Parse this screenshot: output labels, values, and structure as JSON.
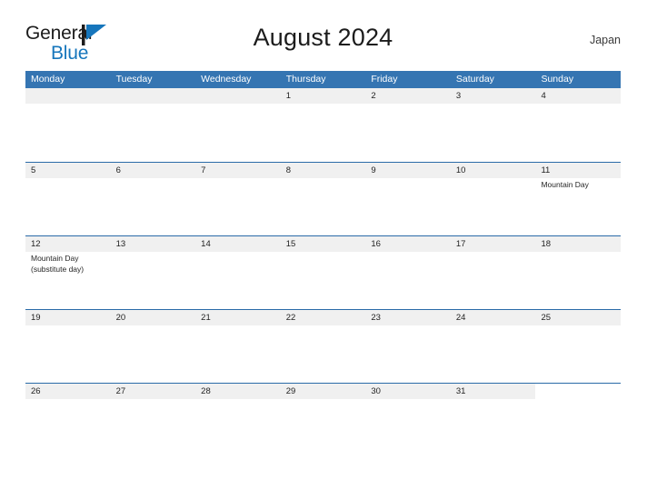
{
  "brand": {
    "name_part1": "General",
    "name_part2": "Blue",
    "flag_icon": "blue-triangle-flag-icon",
    "accent_color": "#1676bc"
  },
  "header": {
    "title": "August 2024",
    "country": "Japan"
  },
  "theme": {
    "header_blue": "#3575b2",
    "divider_blue": "#2a6ba8",
    "band_gray": "#f0f0f0",
    "text_dark": "#222222",
    "page_background": "#ffffff"
  },
  "calendar": {
    "weekdays": [
      "Monday",
      "Tuesday",
      "Wednesday",
      "Thursday",
      "Friday",
      "Saturday",
      "Sunday"
    ],
    "weeks": [
      {
        "band_columns": 7,
        "days": [
          {
            "num": "",
            "events": []
          },
          {
            "num": "",
            "events": []
          },
          {
            "num": "",
            "events": []
          },
          {
            "num": "1",
            "events": []
          },
          {
            "num": "2",
            "events": []
          },
          {
            "num": "3",
            "events": []
          },
          {
            "num": "4",
            "events": []
          }
        ]
      },
      {
        "band_columns": 7,
        "days": [
          {
            "num": "5",
            "events": []
          },
          {
            "num": "6",
            "events": []
          },
          {
            "num": "7",
            "events": []
          },
          {
            "num": "8",
            "events": []
          },
          {
            "num": "9",
            "events": []
          },
          {
            "num": "10",
            "events": []
          },
          {
            "num": "11",
            "events": [
              "Mountain Day"
            ]
          }
        ]
      },
      {
        "band_columns": 7,
        "days": [
          {
            "num": "12",
            "events": [
              "Mountain Day",
              "(substitute day)"
            ]
          },
          {
            "num": "13",
            "events": []
          },
          {
            "num": "14",
            "events": []
          },
          {
            "num": "15",
            "events": []
          },
          {
            "num": "16",
            "events": []
          },
          {
            "num": "17",
            "events": []
          },
          {
            "num": "18",
            "events": []
          }
        ]
      },
      {
        "band_columns": 7,
        "days": [
          {
            "num": "19",
            "events": []
          },
          {
            "num": "20",
            "events": []
          },
          {
            "num": "21",
            "events": []
          },
          {
            "num": "22",
            "events": []
          },
          {
            "num": "23",
            "events": []
          },
          {
            "num": "24",
            "events": []
          },
          {
            "num": "25",
            "events": []
          }
        ]
      },
      {
        "band_columns": 6,
        "days": [
          {
            "num": "26",
            "events": []
          },
          {
            "num": "27",
            "events": []
          },
          {
            "num": "28",
            "events": []
          },
          {
            "num": "29",
            "events": []
          },
          {
            "num": "30",
            "events": []
          },
          {
            "num": "31",
            "events": []
          },
          {
            "num": "",
            "events": []
          }
        ]
      }
    ]
  }
}
